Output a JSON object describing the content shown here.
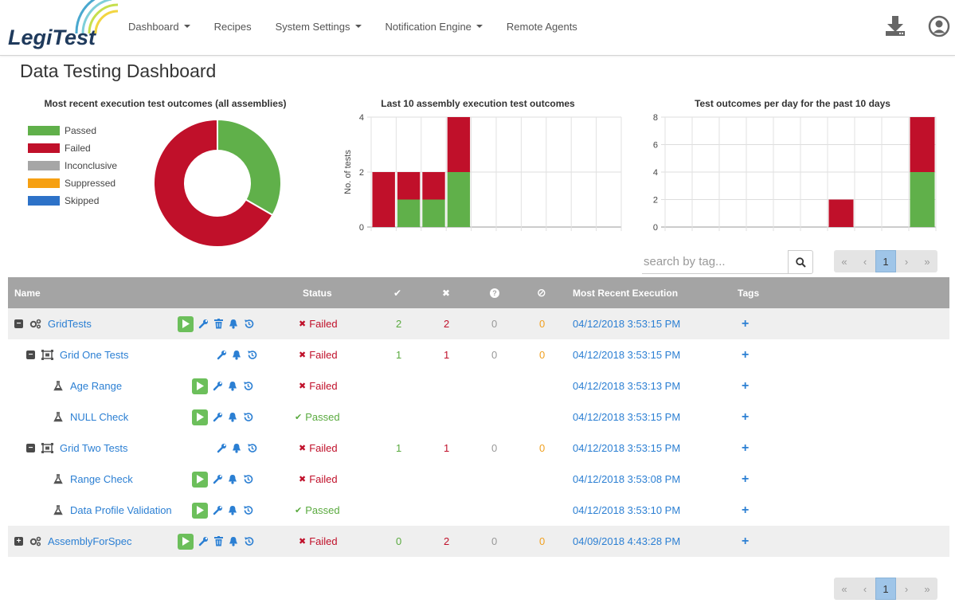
{
  "app": {
    "logo_text": "LegiTest",
    "page_title": "Data Testing Dashboard"
  },
  "nav": {
    "items": [
      {
        "label": "Dashboard",
        "dropdown": true
      },
      {
        "label": "Recipes",
        "dropdown": false
      },
      {
        "label": "System Settings",
        "dropdown": true
      },
      {
        "label": "Notification Engine",
        "dropdown": true
      },
      {
        "label": "Remote Agents",
        "dropdown": false
      }
    ],
    "right_icons": [
      "download-icon",
      "user-icon"
    ]
  },
  "colors": {
    "passed": "#60b04a",
    "failed": "#c0102a",
    "inconclusive": "#a6a6a6",
    "suppressed": "#f6a012",
    "skipped": "#2d72c8",
    "link": "#2b7fd3",
    "header": "#a4a4a4"
  },
  "legend": [
    {
      "label": "Passed",
      "color": "#60b04a"
    },
    {
      "label": "Failed",
      "color": "#c0102a"
    },
    {
      "label": "Inconclusive",
      "color": "#a6a6a6"
    },
    {
      "label": "Suppressed",
      "color": "#f6a012"
    },
    {
      "label": "Skipped",
      "color": "#2d72c8"
    }
  ],
  "chart_data": [
    {
      "type": "pie",
      "title": "Most recent execution test outcomes (all assemblies)",
      "donut": true,
      "slices": [
        {
          "label": "Passed",
          "value": 2
        },
        {
          "label": "Failed",
          "value": 4
        },
        {
          "label": "Inconclusive",
          "value": 0
        },
        {
          "label": "Suppressed",
          "value": 0
        },
        {
          "label": "Skipped",
          "value": 0
        }
      ]
    },
    {
      "type": "bar",
      "stacked": true,
      "title": "Last 10 assembly execution test outcomes",
      "ylabel": "No. of tests",
      "xlabel": "",
      "ylim": [
        0,
        4
      ],
      "yticks": [
        0,
        2,
        4
      ],
      "grid": true,
      "slots": 10,
      "series": [
        {
          "name": "Passed",
          "values": [
            0,
            1,
            1,
            2,
            0,
            0,
            0,
            0,
            0,
            0
          ]
        },
        {
          "name": "Failed",
          "values": [
            2,
            1,
            1,
            2,
            0,
            0,
            0,
            0,
            0,
            0
          ]
        }
      ]
    },
    {
      "type": "bar",
      "stacked": true,
      "title": "Test outcomes per day for the past 10 days",
      "ylabel": "",
      "xlabel": "",
      "ylim": [
        0,
        8
      ],
      "yticks": [
        0,
        2,
        4,
        6,
        8
      ],
      "grid": true,
      "slots": 10,
      "series": [
        {
          "name": "Passed",
          "values": [
            0,
            0,
            0,
            0,
            0,
            0,
            0,
            0,
            0,
            4
          ]
        },
        {
          "name": "Failed",
          "values": [
            0,
            0,
            0,
            0,
            0,
            0,
            2,
            0,
            0,
            4
          ]
        }
      ]
    }
  ],
  "search": {
    "placeholder": "search by tag..."
  },
  "pagination": {
    "first": "«",
    "prev": "‹",
    "current": "1",
    "next": "›",
    "last": "»"
  },
  "table": {
    "headers": {
      "name": "Name",
      "status": "Status",
      "passed_icon": "✔",
      "failed_icon": "✖",
      "inconclusive_icon": "?",
      "suppressed_icon": "⊘",
      "most_recent": "Most Recent Execution",
      "tags": "Tags"
    },
    "rows": [
      {
        "level": 0,
        "kind": "assembly",
        "toggle": "−",
        "name": "GridTests",
        "run": true,
        "delete": true,
        "status": "Failed",
        "passed": "2",
        "failed": "2",
        "inconclusive": "0",
        "suppressed": "0",
        "date": "04/12/2018 3:53:15 PM",
        "tag": "+"
      },
      {
        "level": 1,
        "kind": "grid",
        "toggle": "−",
        "name": "Grid One Tests",
        "run": false,
        "delete": false,
        "status": "Failed",
        "passed": "1",
        "failed": "1",
        "inconclusive": "0",
        "suppressed": "0",
        "date": "04/12/2018 3:53:15 PM",
        "tag": "+"
      },
      {
        "level": 2,
        "kind": "test",
        "toggle": "",
        "name": "Age Range",
        "run": true,
        "delete": false,
        "status": "Failed",
        "passed": "",
        "failed": "",
        "inconclusive": "",
        "suppressed": "",
        "date": "04/12/2018 3:53:13 PM",
        "tag": "+"
      },
      {
        "level": 2,
        "kind": "test",
        "toggle": "",
        "name": "NULL Check",
        "run": true,
        "delete": false,
        "status": "Passed",
        "passed": "",
        "failed": "",
        "inconclusive": "",
        "suppressed": "",
        "date": "04/12/2018 3:53:15 PM",
        "tag": "+"
      },
      {
        "level": 1,
        "kind": "grid",
        "toggle": "−",
        "name": "Grid Two Tests",
        "run": false,
        "delete": false,
        "status": "Failed",
        "passed": "1",
        "failed": "1",
        "inconclusive": "0",
        "suppressed": "0",
        "date": "04/12/2018 3:53:15 PM",
        "tag": "+"
      },
      {
        "level": 2,
        "kind": "test",
        "toggle": "",
        "name": "Range Check",
        "run": true,
        "delete": false,
        "status": "Failed",
        "passed": "",
        "failed": "",
        "inconclusive": "",
        "suppressed": "",
        "date": "04/12/2018 3:53:08 PM",
        "tag": "+"
      },
      {
        "level": 2,
        "kind": "test",
        "toggle": "",
        "name": "Data Profile Validation",
        "run": true,
        "delete": false,
        "status": "Passed",
        "passed": "",
        "failed": "",
        "inconclusive": "",
        "suppressed": "",
        "date": "04/12/2018 3:53:10 PM",
        "tag": "+"
      },
      {
        "level": 0,
        "kind": "assembly",
        "toggle": "+",
        "name": "AssemblyForSpec",
        "run": true,
        "delete": true,
        "status": "Failed",
        "passed": "0",
        "failed": "2",
        "inconclusive": "0",
        "suppressed": "0",
        "date": "04/09/2018 4:43:28 PM",
        "tag": "+"
      }
    ]
  }
}
